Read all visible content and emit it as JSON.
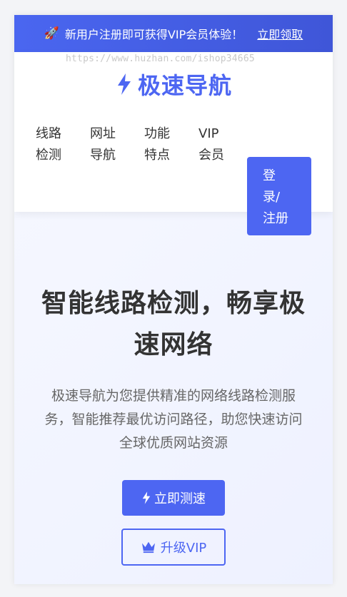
{
  "promo": {
    "icon": "rocket-icon",
    "text": "新用户注册即可获得VIP会员体验！",
    "cta": "立即领取"
  },
  "watermark": "https://www.huzhan.com/ishop34665",
  "brand": {
    "icon": "bolt-icon",
    "name": "极速导航",
    "color": "#4d66f2"
  },
  "nav": {
    "items": [
      {
        "line1": "线路",
        "line2": "检测"
      },
      {
        "line1": "网址",
        "line2": "导航"
      },
      {
        "line1": "功能",
        "line2": "特点"
      },
      {
        "line1": "VIP",
        "line2": "会员"
      }
    ],
    "login": {
      "line1": "登",
      "line2": "录/",
      "line3": "注册"
    }
  },
  "hero": {
    "title_line1": "智能线路检测，畅享极",
    "title_line2": "速网络",
    "desc_line1": "极速导航为您提供精准的网络线路检测服",
    "desc_line2": "务，智能推荐最优访问路径，助您快速访问",
    "desc_line3": "全球优质网站资源",
    "primary_button": "立即测速",
    "secondary_button": "升级VIP",
    "primary_icon": "bolt-icon",
    "secondary_icon": "crown-icon"
  }
}
